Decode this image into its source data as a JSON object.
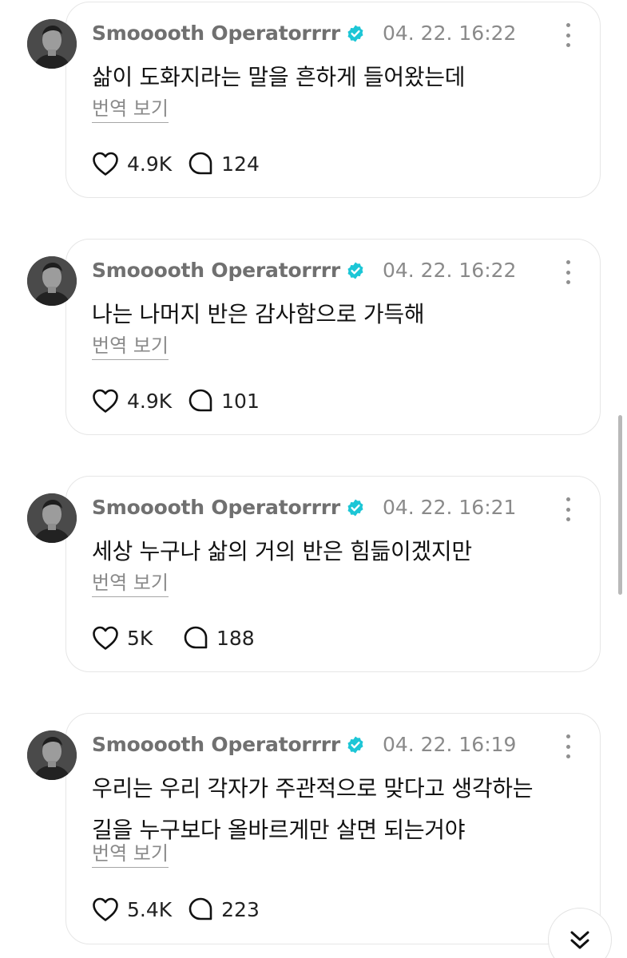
{
  "app": {
    "translate_label": "번역 보기",
    "icons": {
      "verified": "verified-badge-icon",
      "more": "more-vertical-icon",
      "like": "heart-icon",
      "reply": "comment-bubble-icon",
      "scroll": "double-chevron-down-icon"
    },
    "colors": {
      "verified_badge": "#1cc6d6",
      "username": "#707070",
      "timestamp": "#8a8a8a",
      "card_border": "#e6e6e6"
    }
  },
  "posts": [
    {
      "username": "Smooooth Operatorrrr",
      "timestamp": "04. 22. 16:22",
      "text_lines": [
        "삶이 도화지라는 말을 흔하게 들어왔는데"
      ],
      "likes": "4.9K",
      "replies": "124"
    },
    {
      "username": "Smooooth Operatorrrr",
      "timestamp": "04. 22. 16:22",
      "text_lines": [
        "나는 나머지 반은 감사함으로 가득해"
      ],
      "likes": "4.9K",
      "replies": "101"
    },
    {
      "username": "Smooooth Operatorrrr",
      "timestamp": "04. 22. 16:21",
      "text_lines": [
        "세상 누구나 삶의 거의 반은 힘듦이겠지만"
      ],
      "likes": "5K",
      "replies": "188"
    },
    {
      "username": "Smooooth Operatorrrr",
      "timestamp": "04. 22. 16:19",
      "text_lines": [
        "우리는 우리 각자가 주관적으로 맞다고 생각하는",
        "길을 누구보다 올바르게만 살면 되는거야"
      ],
      "likes": "5.4K",
      "replies": "223"
    }
  ]
}
